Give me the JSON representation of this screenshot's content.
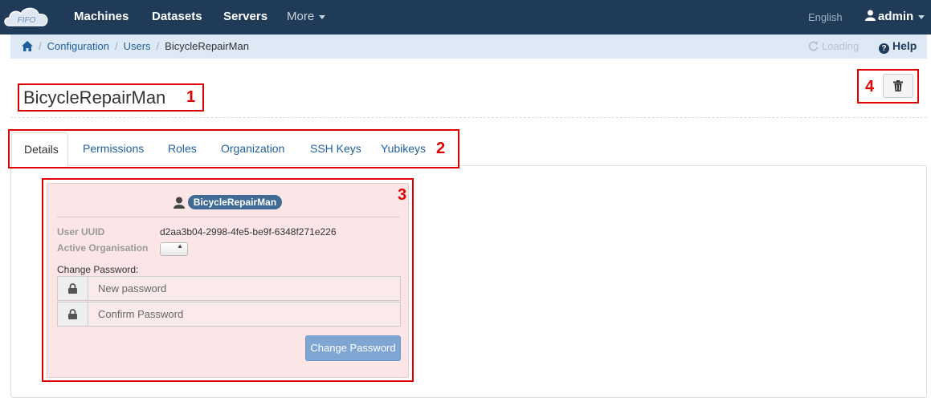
{
  "navbar": {
    "logo_text": "FIFO",
    "items": [
      "Machines",
      "Datasets",
      "Servers"
    ],
    "more_label": "More",
    "language": "English",
    "user": "admin"
  },
  "breadcrumb": {
    "items": [
      "Configuration",
      "Users"
    ],
    "current": "BicycleRepairMan",
    "loading": "Loading",
    "help": "Help"
  },
  "page": {
    "title": "BicycleRepairMan"
  },
  "annotations": [
    "1",
    "2",
    "3",
    "4"
  ],
  "tabs": [
    "Details",
    "Permissions",
    "Roles",
    "Organization",
    "SSH Keys",
    "Yubikeys"
  ],
  "details": {
    "username_badge": "BicycleRepairMan",
    "uuid_label": "User UUID",
    "uuid_value": "d2aa3b04-2998-4fe5-be9f-6348f271e226",
    "active_org_label": "Active Organisation",
    "active_org_value": "",
    "change_password_label": "Change Password:",
    "new_password_placeholder": "New password",
    "confirm_password_placeholder": "Confirm Password",
    "change_password_button": "Change Password"
  },
  "colors": {
    "navbar": "#1f3b57",
    "annotation": "#e00000",
    "panel": "#fbe5e7",
    "button": "#7fa6d3"
  }
}
